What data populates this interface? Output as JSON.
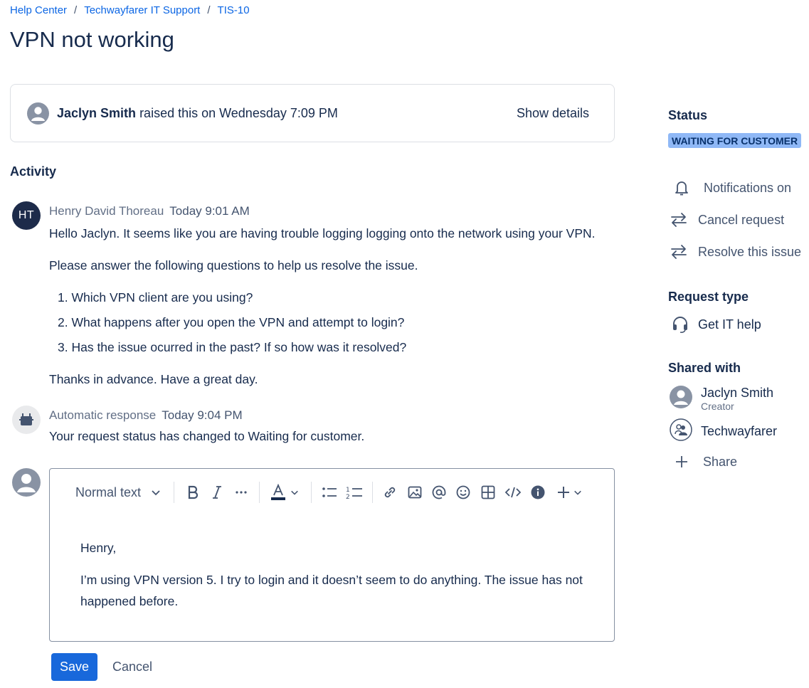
{
  "breadcrumb": {
    "items": [
      "Help Center",
      "Techwayfarer IT Support",
      "TIS-10"
    ],
    "separator": "/"
  },
  "page_title": "VPN not working",
  "raised": {
    "reporter": "Jaclyn Smith",
    "text": "raised this on Wednesday 7:09 PM",
    "show_details": "Show details"
  },
  "activity": {
    "heading": "Activity",
    "comment1": {
      "initials": "HT",
      "author": "Henry David Thoreau",
      "time": "Today 9:01 AM",
      "p1": "Hello Jaclyn. It seems like you are having trouble logging logging onto the network using your VPN.",
      "p2": "Please answer the following questions to help us resolve the issue.",
      "list": [
        "1. Which VPN client are you using?",
        "2. What happens after you open the VPN and attempt to login?",
        "3. Has the issue ocurred in the past? If so how was it resolved?"
      ],
      "p3": "Thanks in advance. Have a great day."
    },
    "comment2": {
      "author": "Automatic response",
      "time": "Today 9:04 PM",
      "body": "Your request status has changed to Waiting for customer."
    }
  },
  "editor": {
    "text_style": "Normal text",
    "line1": "Henry,",
    "line2": "I’m using VPN version 5. I try to login and it doesn’t seem to do anything. The issue has not",
    "line3": "happened before.",
    "save_label": "Save",
    "cancel_label": "Cancel"
  },
  "sidebar": {
    "status_heading": "Status",
    "status_value": "WAITING FOR CUSTOMER",
    "actions": [
      "Notifications on",
      "Cancel request",
      "Resolve this issue"
    ],
    "request_type_heading": "Request type",
    "request_type": "Get IT help",
    "shared_heading": "Shared with",
    "shared": [
      {
        "name": "Jaclyn Smith",
        "role": "Creator"
      },
      {
        "name": "Techwayfarer",
        "role": ""
      }
    ],
    "share_label": "Share"
  },
  "colors": {
    "link": "#0c66e4",
    "primary_button": "#1868db",
    "status_lozenge": "#8fb8f6",
    "avatar_dark": "#1d2b4a"
  }
}
